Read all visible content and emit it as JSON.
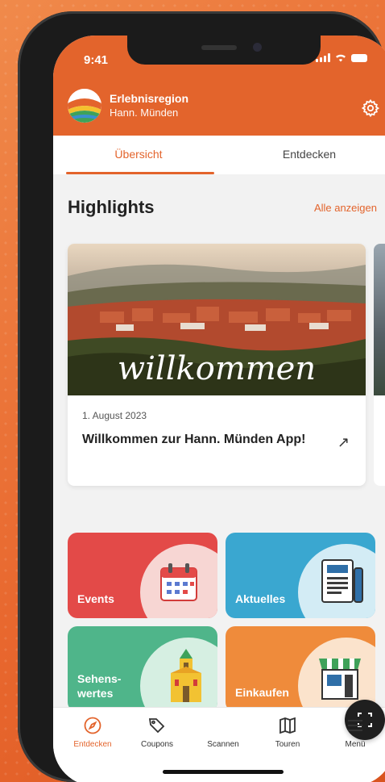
{
  "status_bar": {
    "time": "9:41"
  },
  "brand": {
    "title": "Erlebnisregion",
    "subtitle": "Hann. Münden"
  },
  "tabs": [
    {
      "label": "Übersicht",
      "active": true
    },
    {
      "label": "Entdecken",
      "active": false
    }
  ],
  "highlights": {
    "title": "Highlights",
    "show_all": "Alle anzeigen",
    "card": {
      "image_text": "willkommen",
      "date": "1. August 2023",
      "title": "Willkommen zur Hann. Münden App!",
      "arrow_icon": "arrow-up-right-icon"
    }
  },
  "tiles": [
    {
      "label": "Events",
      "icon": "calendar-icon",
      "color": "#e34a48"
    },
    {
      "label": "Aktuelles",
      "icon": "newspaper-icon",
      "color": "#3aa7d0"
    },
    {
      "label_line1": "Sehens-",
      "label_line2": "wertes",
      "icon": "landmark-icon",
      "color": "#4fb58a"
    },
    {
      "label": "Einkaufen",
      "icon": "shop-icon",
      "color": "#ef8b3b"
    }
  ],
  "bottom_nav": [
    {
      "label": "Entdecken",
      "icon": "compass-icon",
      "active": true
    },
    {
      "label": "Coupons",
      "icon": "tag-icon",
      "active": false
    },
    {
      "label": "Scannen",
      "icon": "scan-icon",
      "active": false
    },
    {
      "label": "Touren",
      "icon": "map-icon",
      "active": false
    },
    {
      "label": "Menü",
      "icon": "menu-icon",
      "active": false
    }
  ],
  "colors": {
    "accent": "#e3642c",
    "background": "#f2f2f2"
  }
}
